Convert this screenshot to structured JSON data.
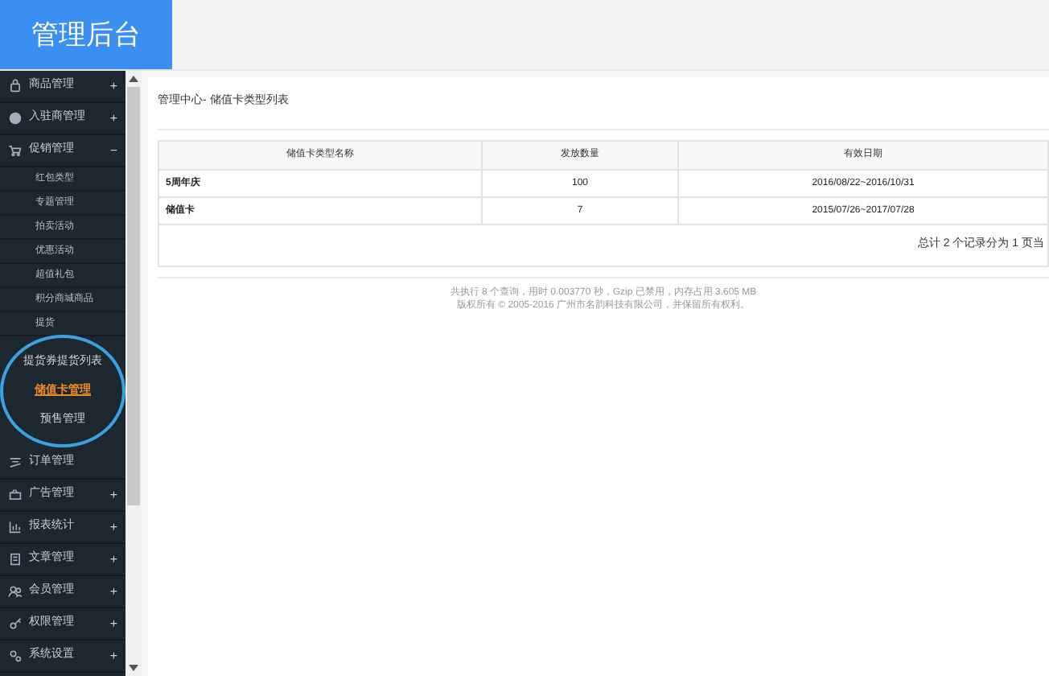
{
  "header": {
    "title": "管理后台"
  },
  "sidebar": {
    "items": [
      {
        "label": "商品管理",
        "toggle": "+"
      },
      {
        "label": "入驻商管理",
        "toggle": "+"
      },
      {
        "label": "促销管理",
        "toggle": "−",
        "children": [
          {
            "label": "红包类型",
            "selected": false
          },
          {
            "label": "专题管理",
            "selected": false
          },
          {
            "label": "拍卖活动",
            "selected": false
          },
          {
            "label": "优惠活动",
            "selected": false
          },
          {
            "label": "超值礼包",
            "selected": false
          },
          {
            "label": "积分商城商品",
            "selected": false
          },
          {
            "label": "提货",
            "selected": false
          }
        ]
      },
      {
        "label": "订单管理"
      },
      {
        "label": "广告管理",
        "toggle": "+"
      },
      {
        "label": "报表统计",
        "toggle": "+"
      },
      {
        "label": "文章管理",
        "toggle": "+"
      },
      {
        "label": "会员管理",
        "toggle": "+"
      },
      {
        "label": "权限管理",
        "toggle": "+"
      },
      {
        "label": "系统设置",
        "toggle": "+"
      }
    ]
  },
  "magnifier": {
    "items": [
      {
        "label": "提货券提货列表",
        "selected": false
      },
      {
        "label": "储值卡管理",
        "selected": true
      },
      {
        "label": "预售管理",
        "selected": false
      }
    ]
  },
  "breadcrumb": "管理中心- 储值卡类型列表",
  "table": {
    "columns": [
      "储值卡类型名称",
      "发放数量",
      "有效日期"
    ],
    "rows": [
      [
        "5周年庆",
        "100",
        "2016/08/22~2016/10/31"
      ],
      [
        "储值卡",
        "7",
        "2015/07/26~2017/07/28"
      ]
    ]
  },
  "pager": "总计 2 个记录分为 1 页当",
  "footer": [
    "共执行 8 个查询，用时 0.003770 秒，Gzip 已禁用，内存占用 3.605 MB",
    "版权所有 © 2005-2016 广州市名韵科技有限公司，并保留所有权利。"
  ]
}
